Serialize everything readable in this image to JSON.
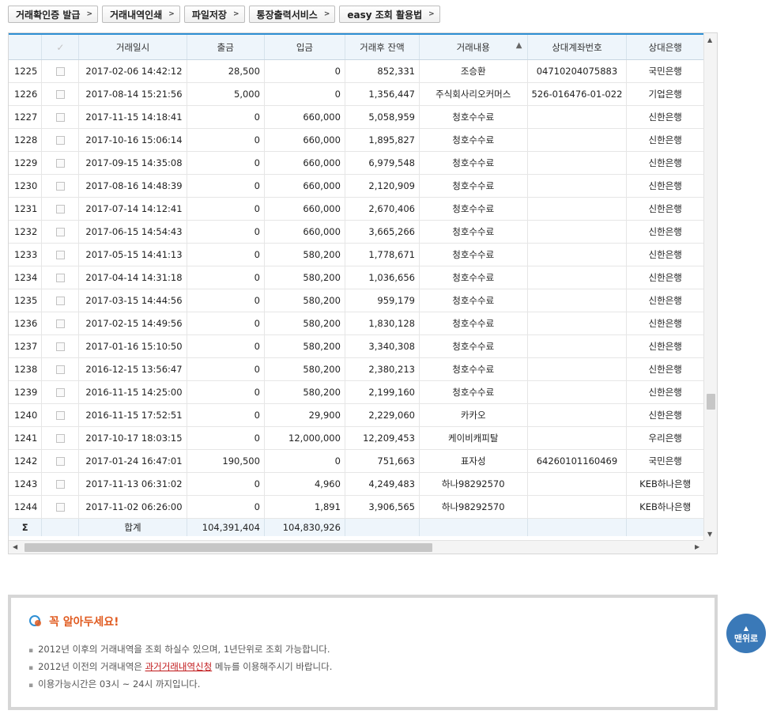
{
  "toolbar": {
    "buttons": [
      "거래확인증 발급",
      "거래내역인쇄",
      "파일저장",
      "통장출력서비스",
      "easy 조회 활용법"
    ]
  },
  "grid": {
    "headers": [
      "",
      "✓",
      "거래일시",
      "출금",
      "입금",
      "거래후 잔액",
      "거래내용",
      "상대계좌번호",
      "상대은행"
    ],
    "sort_column": "거래내용",
    "rows": [
      [
        "1225",
        "2017-02-06 14:42:12",
        "28,500",
        "0",
        "852,331",
        "조승환",
        "04710204075883",
        "국민은행"
      ],
      [
        "1226",
        "2017-08-14 15:21:56",
        "5,000",
        "0",
        "1,356,447",
        "주식회사리오커머스",
        "526-016476-01-022",
        "기업은행"
      ],
      [
        "1227",
        "2017-11-15 14:18:41",
        "0",
        "660,000",
        "5,058,959",
        "청호수수료",
        "",
        "신한은행"
      ],
      [
        "1228",
        "2017-10-16 15:06:14",
        "0",
        "660,000",
        "1,895,827",
        "청호수수료",
        "",
        "신한은행"
      ],
      [
        "1229",
        "2017-09-15 14:35:08",
        "0",
        "660,000",
        "6,979,548",
        "청호수수료",
        "",
        "신한은행"
      ],
      [
        "1230",
        "2017-08-16 14:48:39",
        "0",
        "660,000",
        "2,120,909",
        "청호수수료",
        "",
        "신한은행"
      ],
      [
        "1231",
        "2017-07-14 14:12:41",
        "0",
        "660,000",
        "2,670,406",
        "청호수수료",
        "",
        "신한은행"
      ],
      [
        "1232",
        "2017-06-15 14:54:43",
        "0",
        "660,000",
        "3,665,266",
        "청호수수료",
        "",
        "신한은행"
      ],
      [
        "1233",
        "2017-05-15 14:41:13",
        "0",
        "580,200",
        "1,778,671",
        "청호수수료",
        "",
        "신한은행"
      ],
      [
        "1234",
        "2017-04-14 14:31:18",
        "0",
        "580,200",
        "1,036,656",
        "청호수수료",
        "",
        "신한은행"
      ],
      [
        "1235",
        "2017-03-15 14:44:56",
        "0",
        "580,200",
        "959,179",
        "청호수수료",
        "",
        "신한은행"
      ],
      [
        "1236",
        "2017-02-15 14:49:56",
        "0",
        "580,200",
        "1,830,128",
        "청호수수료",
        "",
        "신한은행"
      ],
      [
        "1237",
        "2017-01-16 15:10:50",
        "0",
        "580,200",
        "3,340,308",
        "청호수수료",
        "",
        "신한은행"
      ],
      [
        "1238",
        "2016-12-15 13:56:47",
        "0",
        "580,200",
        "2,380,213",
        "청호수수료",
        "",
        "신한은행"
      ],
      [
        "1239",
        "2016-11-15 14:25:00",
        "0",
        "580,200",
        "2,199,160",
        "청호수수료",
        "",
        "신한은행"
      ],
      [
        "1240",
        "2016-11-15 17:52:51",
        "0",
        "29,900",
        "2,229,060",
        "카카오",
        "",
        "신한은행"
      ],
      [
        "1241",
        "2017-10-17 18:03:15",
        "0",
        "12,000,000",
        "12,209,453",
        "케이비캐피탈",
        "",
        "우리은행"
      ],
      [
        "1242",
        "2017-01-24 16:47:01",
        "190,500",
        "0",
        "751,663",
        "표자성",
        "64260101160469",
        "국민은행"
      ],
      [
        "1243",
        "2017-11-13 06:31:02",
        "0",
        "4,960",
        "4,249,483",
        "하나98292570",
        "",
        "KEB하나은행"
      ],
      [
        "1244",
        "2017-11-02 06:26:00",
        "0",
        "1,891",
        "3,906,565",
        "하나98292570",
        "",
        "KEB하나은행"
      ]
    ],
    "footer": {
      "sigma": "Σ",
      "label": "합계",
      "withdraw_total": "104,391,404",
      "deposit_total": "104,830,926"
    }
  },
  "notice": {
    "title": "꼭 알아두세요!",
    "item1": "2012년 이후의 거래내역을 조회 하실수 있으며, 1년단위로 조회 가능합니다.",
    "item2_prefix": "2012년 이전의 거래내역은 ",
    "item2_link": "과거거래내역신청",
    "item2_suffix": " 메뉴를 이용해주시기 바랍니다.",
    "item3": "이용가능시간은 03시 ~ 24시 까지입니다."
  },
  "top_button": {
    "label": "맨위로",
    "arrow": "▲"
  },
  "colors": {
    "header_accent": "#2e8fd4",
    "header_bg": "#eef5fb",
    "notice_title": "#e05a1f",
    "link": "#c0181a",
    "top_button": "#3a79b8"
  }
}
